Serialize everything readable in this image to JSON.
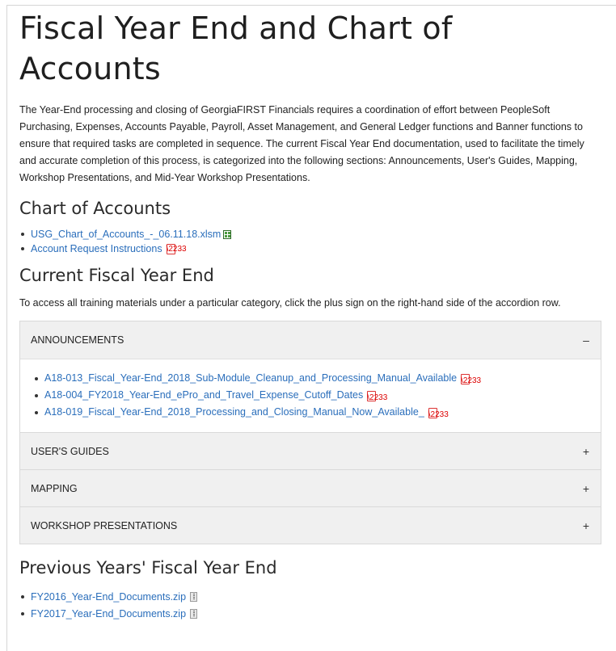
{
  "page": {
    "title": "Fiscal Year End and Chart of Accounts",
    "intro": "The Year-End processing and closing of GeorgiaFIRST Financials requires a coordination of effort between PeopleSoft Purchasing, Expenses, Accounts Payable, Payroll, Asset Management, and General Ledger functions and Banner functions to ensure that required tasks are completed in sequence. The current Fiscal Year End documentation, used to facilitate the timely and accurate completion of this process, is categorized into the following sections: Announcements, User's Guides, Mapping, Workshop Presentations, and Mid-Year Workshop Presentations."
  },
  "chart_of_accounts": {
    "heading": "Chart of Accounts",
    "links": [
      {
        "label": "USG_Chart_of_Accounts_-_06.11.18.xlsm",
        "icon": "excel-file-icon"
      },
      {
        "label": "Account Request Instructions",
        "icon": "pdf-icon"
      }
    ]
  },
  "current_fye": {
    "heading": "Current Fiscal Year End",
    "note": "To access all training materials under a particular category, click the plus sign on the right-hand side of the accordion row.",
    "accordion": [
      {
        "label": "ANNOUNCEMENTS",
        "toggle": "–",
        "expanded": true,
        "links": [
          {
            "label": "A18-013_Fiscal_Year-End_2018_Sub-Module_Cleanup_and_Processing_Manual_Available",
            "icon": "pdf-icon"
          },
          {
            "label": "A18-004_FY2018_Year-End_ePro_and_Travel_Expense_Cutoff_Dates",
            "icon": "pdf-icon"
          },
          {
            "label": "A18-019_Fiscal_Year-End_2018_Processing_and_Closing_Manual_Now_Available_",
            "icon": "pdf-icon"
          }
        ]
      },
      {
        "label": "USER'S GUIDES",
        "toggle": "+",
        "expanded": false
      },
      {
        "label": "MAPPING",
        "toggle": "+",
        "expanded": false
      },
      {
        "label": "WORKSHOP PRESENTATIONS",
        "toggle": "+",
        "expanded": false
      }
    ]
  },
  "previous_fye": {
    "heading": "Previous Years' Fiscal Year End",
    "links": [
      {
        "label": "FY2016_Year-End_Documents.zip",
        "icon": "zip-file-icon"
      },
      {
        "label": "FY2017_Year-End_Documents.zip",
        "icon": "zip-file-icon"
      }
    ]
  },
  "colors": {
    "link": "#2a6ebb",
    "accordion_header_bg": "#f0f0f0",
    "pdf_icon": "#dd0000"
  }
}
